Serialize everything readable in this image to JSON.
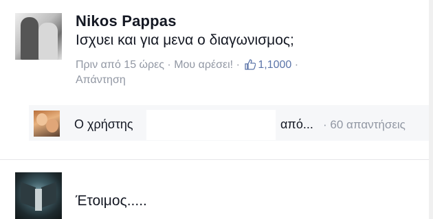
{
  "comments": [
    {
      "author": "Nikos Pappas",
      "text": "Ισχυει και για μενα ο διαγωνισμος;",
      "timestamp": "Πριν από 15 ώρες",
      "separator": "·",
      "like_label": "Μου αρέσει!",
      "like_count": "1,1000",
      "reply_label": "Απάντηση"
    },
    {
      "text": "Έτοιμος....."
    }
  ],
  "replies_bar": {
    "prefix": "Ο χρήστης",
    "truncated_suffix": "από...",
    "count_text": "· 60 απαντήσεις"
  },
  "icons": {
    "like": "thumbs-up-icon"
  },
  "colors": {
    "text": "#141823",
    "meta": "#9197a3",
    "likes": "#5b74a8",
    "reply_bg": "#f6f7f9"
  }
}
